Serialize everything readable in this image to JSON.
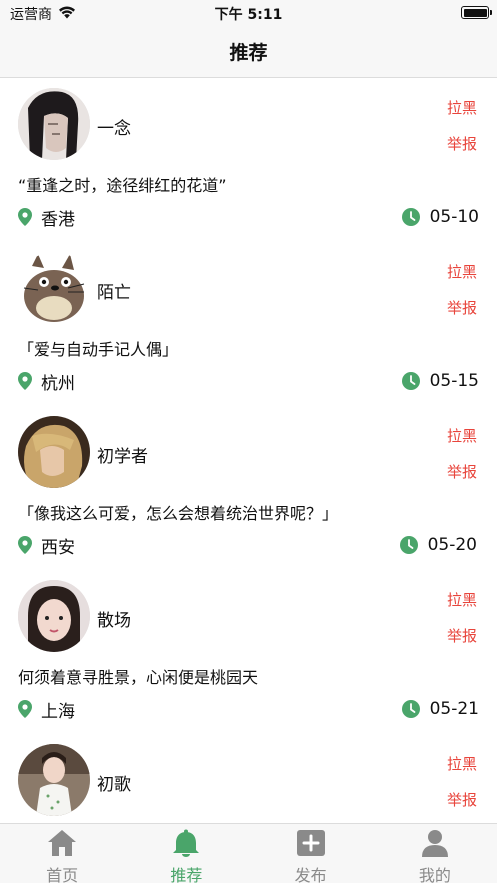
{
  "status_bar": {
    "carrier": "运营商",
    "time": "下午 5:11"
  },
  "nav": {
    "title": "推荐"
  },
  "colors": {
    "accent_green": "#4aa56a",
    "action_red": "#e8453c",
    "icon_gray": "#8a8a8a"
  },
  "cards": [
    {
      "name": "一念",
      "quote": "“重逢之时，途径绯红的花道”",
      "location": "香港",
      "date": "05-10",
      "block_label": "拉黑",
      "report_label": "举报"
    },
    {
      "name": "陌亡",
      "quote": "「爱与自动手记人偶」",
      "location": "杭州",
      "date": "05-15",
      "block_label": "拉黑",
      "report_label": "举报"
    },
    {
      "name": "初学者",
      "quote": "「像我这么可爱，怎么会想着统治世界呢？」",
      "location": "西安",
      "date": "05-20",
      "block_label": "拉黑",
      "report_label": "举报"
    },
    {
      "name": "散场",
      "quote": "何须着意寻胜景，心闲便是桃园天",
      "location": "上海",
      "date": "05-21",
      "block_label": "拉黑",
      "report_label": "举报"
    },
    {
      "name": "初歌",
      "quote": "",
      "location": "",
      "date": "",
      "block_label": "拉黑",
      "report_label": "举报"
    }
  ],
  "tabs": [
    {
      "label": "首页",
      "icon": "home-icon",
      "active": false
    },
    {
      "label": "推荐",
      "icon": "bell-icon",
      "active": true
    },
    {
      "label": "发布",
      "icon": "plus-square-icon",
      "active": false
    },
    {
      "label": "我的",
      "icon": "person-icon",
      "active": false
    }
  ]
}
